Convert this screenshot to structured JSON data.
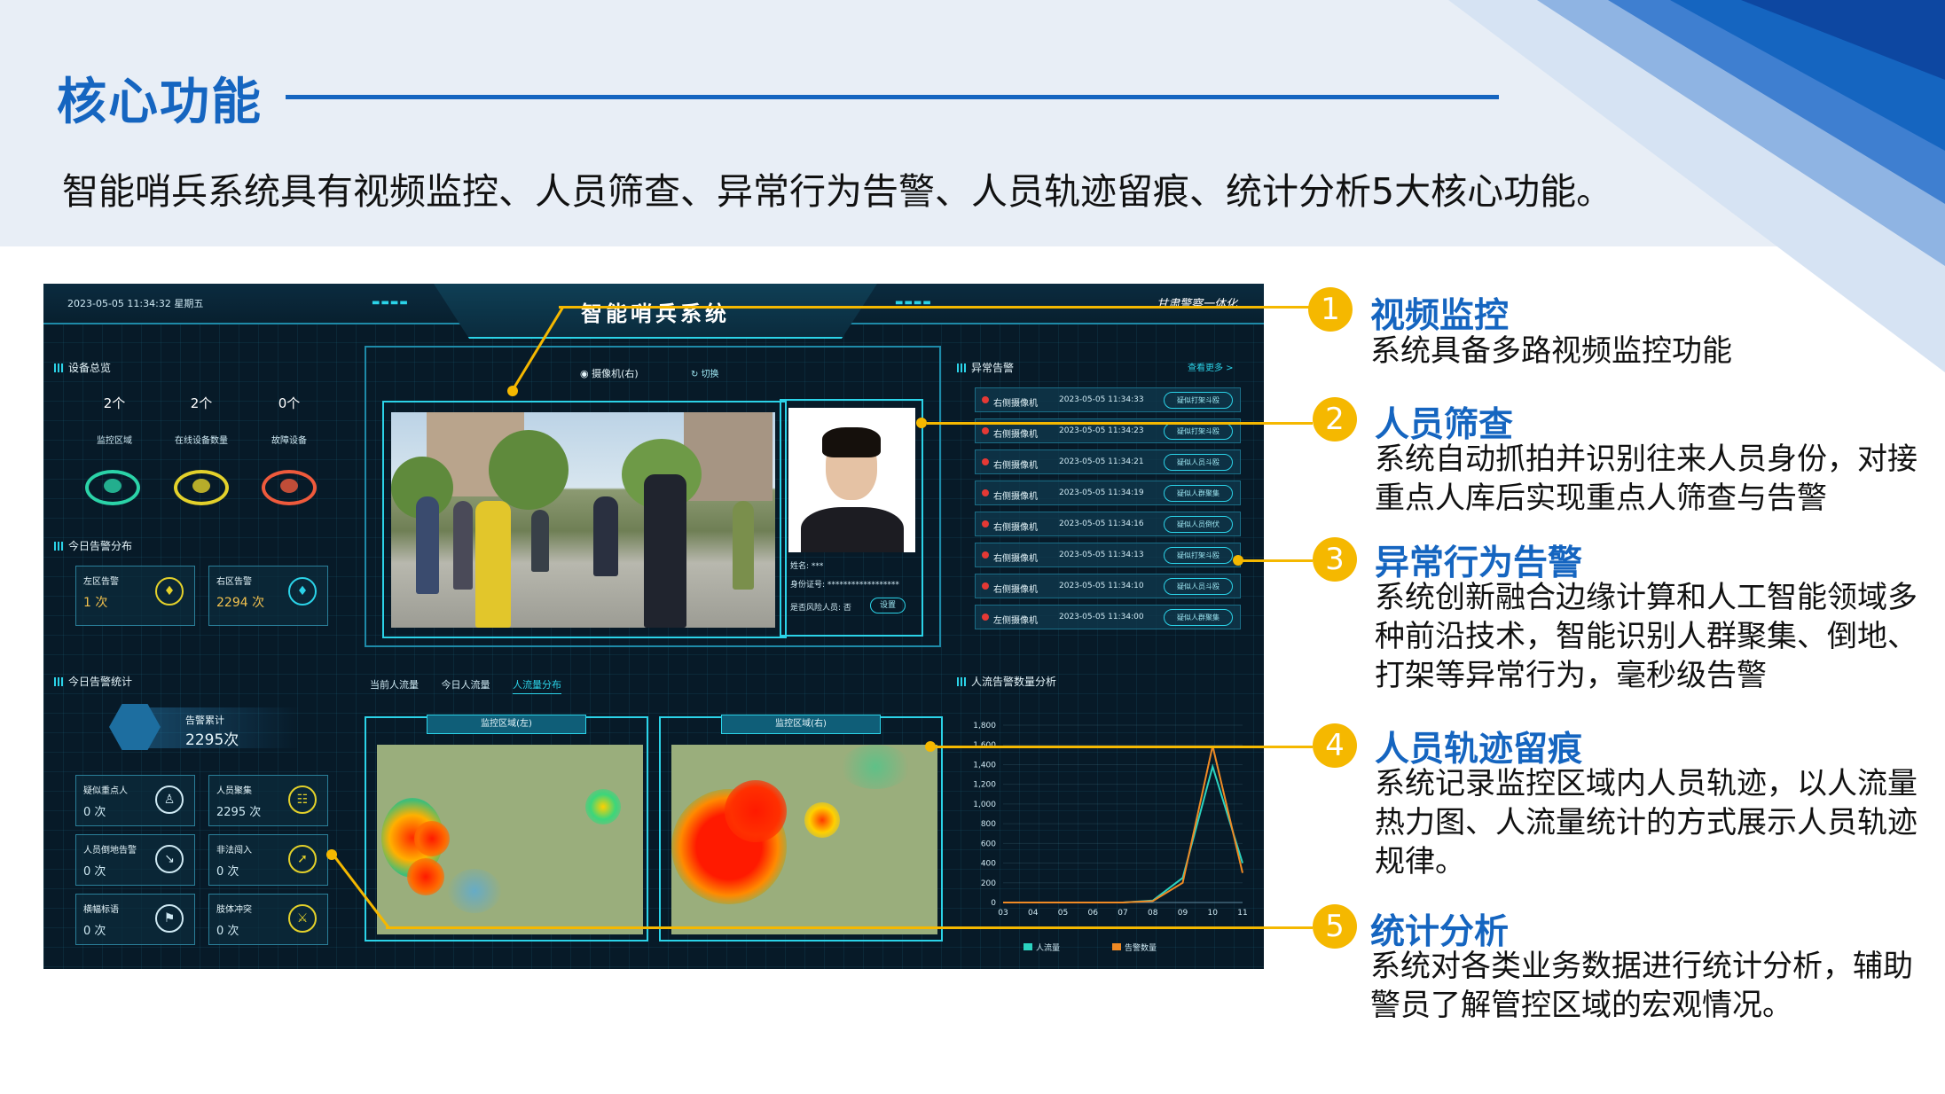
{
  "slide": {
    "title": "核心功能",
    "subtitle": "智能哨兵系统具有视频监控、人员筛查、异常行为告警、人员轨迹留痕、统计分析5大核心功能。"
  },
  "dashboard": {
    "datetime": "2023-05-05 11:34:32 星期五",
    "title": "智能哨兵系统",
    "logo_text": "甘肃警察一体化",
    "device_overview": {
      "title": "设备总览",
      "stats": [
        {
          "value": "2个",
          "label": "监控区域"
        },
        {
          "value": "2个",
          "label": "在线设备数量"
        },
        {
          "value": "0个",
          "label": "故障设备"
        }
      ]
    },
    "alarm_distribution": {
      "title": "今日告警分布",
      "left": {
        "label": "左区告警",
        "value": "1 次"
      },
      "right": {
        "label": "右区告警",
        "value": "2294 次"
      }
    },
    "camera": {
      "name": "摄像机(右)",
      "switch": "切换"
    },
    "person_info": {
      "name": "姓名: ***",
      "id": "身份证号: ******************",
      "risk": "是否风险人员: 否",
      "button": "设置"
    },
    "alerts": {
      "title": "异常告警",
      "more": "查看更多 >",
      "rows": [
        {
          "camera": "右侧摄像机",
          "time": "2023-05-05 11:34:33",
          "tag": "疑似打架斗殴"
        },
        {
          "camera": "右侧摄像机",
          "time": "2023-05-05 11:34:23",
          "tag": "疑似打架斗殴"
        },
        {
          "camera": "右侧摄像机",
          "time": "2023-05-05 11:34:21",
          "tag": "疑似人员斗殴"
        },
        {
          "camera": "右侧摄像机",
          "time": "2023-05-05 11:34:19",
          "tag": "疑似人群聚集"
        },
        {
          "camera": "右侧摄像机",
          "time": "2023-05-05 11:34:16",
          "tag": "疑似人员倒伏"
        },
        {
          "camera": "右侧摄像机",
          "time": "2023-05-05 11:34:13",
          "tag": "疑似打架斗殴"
        },
        {
          "camera": "右侧摄像机",
          "time": "2023-05-05 11:34:10",
          "tag": "疑似人员斗殴"
        },
        {
          "camera": "左侧摄像机",
          "time": "2023-05-05 11:34:00",
          "tag": "疑似人群聚集"
        }
      ]
    },
    "today_stats": {
      "title": "今日告警统计",
      "total_label": "告警累计",
      "total_value": "2295次",
      "items": [
        {
          "label": "疑似重点人",
          "value": "0 次",
          "icon": "person-icon"
        },
        {
          "label": "人员聚集",
          "value": "2295 次",
          "icon": "group-icon"
        },
        {
          "label": "人员倒地告警",
          "value": "0 次",
          "icon": "fall-icon"
        },
        {
          "label": "非法闯入",
          "value": "0 次",
          "icon": "run-icon"
        },
        {
          "label": "横幅标语",
          "value": "0 次",
          "icon": "flag-icon"
        },
        {
          "label": "肢体冲突",
          "value": "0 次",
          "icon": "conflict-icon"
        }
      ]
    },
    "flow_tabs": [
      "当前人流量",
      "今日人流量",
      "人流量分布"
    ],
    "heatmaps": [
      {
        "label": "监控区域(左)"
      },
      {
        "label": "监控区域(右)"
      }
    ],
    "chart_title": "人流告警数量分析"
  },
  "chart_data": {
    "type": "line",
    "title": "人流告警数量分析",
    "x": [
      "03",
      "04",
      "05",
      "06",
      "07",
      "08",
      "09",
      "10",
      "11"
    ],
    "yticks": [
      "0",
      "200",
      "400",
      "600",
      "800",
      "1,000",
      "1,200",
      "1,400",
      "1,600",
      "1,800"
    ],
    "ylim": [
      0,
      1800
    ],
    "series": [
      {
        "name": "人流量",
        "color": "#2bd3c0",
        "values": [
          0,
          0,
          0,
          0,
          0,
          20,
          250,
          1380,
          400
        ]
      },
      {
        "name": "告警数量",
        "color": "#f08a24",
        "values": [
          0,
          0,
          0,
          0,
          0,
          15,
          200,
          1590,
          300
        ]
      }
    ]
  },
  "features": [
    {
      "num": "1",
      "title": "视频监控",
      "desc": "系统具备多路视频监控功能"
    },
    {
      "num": "2",
      "title": "人员筛查",
      "desc": "系统自动抓拍并识别往来人员身份，对接重点人库后实现重点人筛查与告警"
    },
    {
      "num": "3",
      "title": "异常行为告警",
      "desc": "系统创新融合边缘计算和人工智能领域多种前沿技术，智能识别人群聚集、倒地、打架等异常行为，毫秒级告警"
    },
    {
      "num": "4",
      "title": "人员轨迹留痕",
      "desc": "系统记录监控区域内人员轨迹，以人流量热力图、人流量统计的方式展示人员轨迹规律。"
    },
    {
      "num": "5",
      "title": "统计分析",
      "desc": "系统对各类业务数据进行统计分析，辅助警员了解管控区域的宏观情况。"
    }
  ],
  "colors": {
    "brand_blue": "#1565c0",
    "accent_yellow": "#f5b800",
    "dash_bg": "#071a28",
    "dash_cyan": "#2bd3e8"
  }
}
